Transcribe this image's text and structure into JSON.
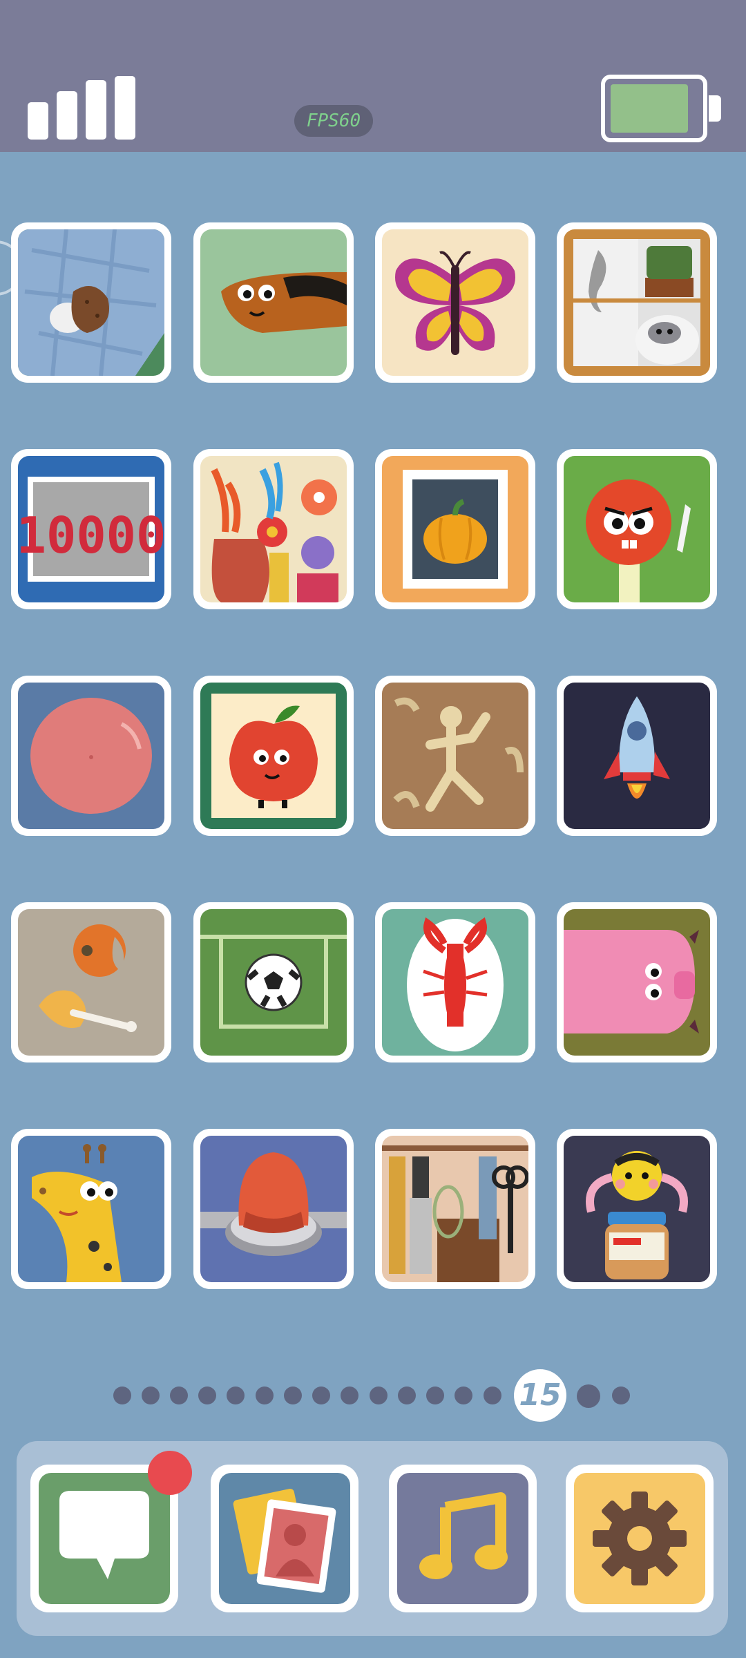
{
  "status_bar": {
    "fps_label": "FPS60",
    "signal_bars": 4,
    "battery_level": 0.8
  },
  "page_indicator": {
    "current_page": "15",
    "total_pages": 17
  },
  "colors": {
    "background": "#7fa3c1",
    "status_bar": "#7b7c98",
    "badge": "#e84a4f"
  },
  "grid_apps": [
    {
      "icon": "stone-on-blanket-icon"
    },
    {
      "icon": "sleeping-dog-icon"
    },
    {
      "icon": "butterfly-icon"
    },
    {
      "icon": "cat-cactus-shelf-icon"
    },
    {
      "icon": "counter-10000-icon"
    },
    {
      "icon": "flower-vases-icon"
    },
    {
      "icon": "pumpkin-stamp-icon"
    },
    {
      "icon": "red-monster-knife-icon"
    },
    {
      "icon": "pink-bubble-icon"
    },
    {
      "icon": "apple-character-icon"
    },
    {
      "icon": "cave-painting-icon"
    },
    {
      "icon": "rocket-icon"
    },
    {
      "icon": "food-scraps-icon"
    },
    {
      "icon": "soccer-ball-icon"
    },
    {
      "icon": "lobster-plate-icon"
    },
    {
      "icon": "pig-icon"
    },
    {
      "icon": "giraffe-icon"
    },
    {
      "icon": "red-button-icon"
    },
    {
      "icon": "kitchen-tools-icon"
    },
    {
      "icon": "bee-peanut-jar-icon"
    }
  ],
  "counter_text": "10000",
  "dock_apps": [
    {
      "icon": "messages-icon",
      "has_badge": true
    },
    {
      "icon": "photos-icon"
    },
    {
      "icon": "music-icon"
    },
    {
      "icon": "settings-icon"
    }
  ]
}
